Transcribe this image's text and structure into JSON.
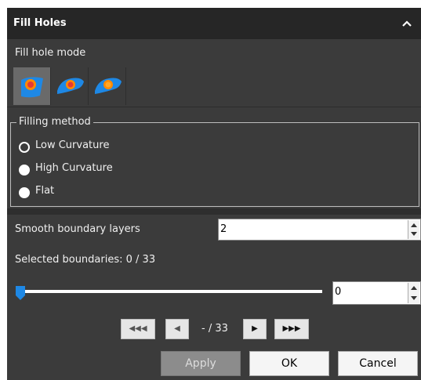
{
  "panel": {
    "title": "Fill Holes",
    "collapse_icon": "chevron-up-icon"
  },
  "fill_hole_mode": {
    "label": "Fill hole mode",
    "modes": [
      {
        "icon": "fill-hole-mode-1-icon",
        "selected": true
      },
      {
        "icon": "fill-hole-mode-2-icon",
        "selected": false
      },
      {
        "icon": "fill-hole-mode-3-icon",
        "selected": false
      }
    ]
  },
  "filling_method": {
    "label": "Filling method",
    "options": [
      {
        "label": "Low Curvature",
        "selected": true
      },
      {
        "label": "High Curvature",
        "selected": false
      },
      {
        "label": "Flat",
        "selected": false
      }
    ]
  },
  "smooth_boundary_layers": {
    "label": "Smooth boundary layers",
    "value": "2"
  },
  "selected_boundaries": {
    "text": "Selected boundaries: 0 / 33"
  },
  "slider": {
    "value": "0",
    "position_fraction": 0
  },
  "navigation": {
    "first_label": "◀◀◀",
    "prev_label": "◀",
    "page_text": "- / 33",
    "next_label": "▶",
    "last_label": "▶▶▶"
  },
  "actions": {
    "apply_label": "Apply",
    "ok_label": "OK",
    "cancel_label": "Cancel"
  },
  "colors": {
    "panel_bg": "#3b3b3b",
    "header_bg": "#262626",
    "shape_blue": "#1e88e5",
    "hole_orange": "#ff8a00",
    "hole_red": "#e53935"
  }
}
